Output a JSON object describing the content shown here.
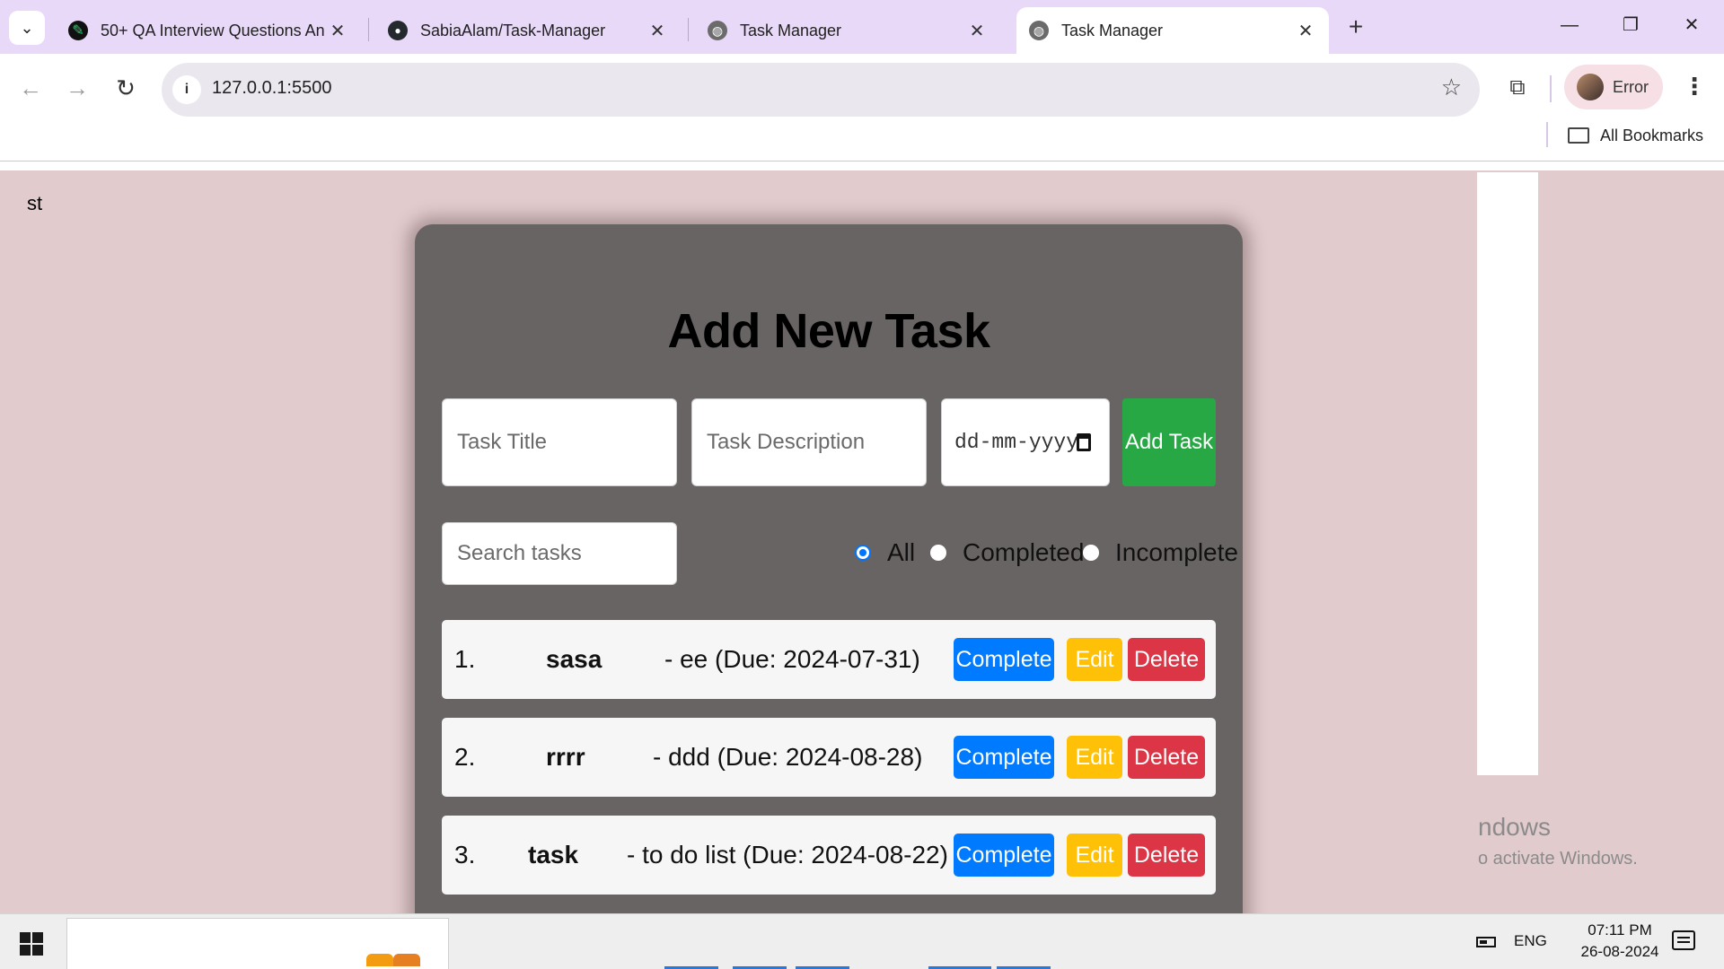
{
  "browser": {
    "tabs": [
      {
        "title": "50+ QA Interview Questions An",
        "active": false
      },
      {
        "title": "SabiaAlam/Task-Manager",
        "active": false
      },
      {
        "title": "Task Manager",
        "active": false
      },
      {
        "title": "Task Manager",
        "active": true
      }
    ],
    "url": "127.0.0.1:5500",
    "profile_label": "Error",
    "bookmarks_label": "All Bookmarks",
    "new_tab": "+",
    "close_glyph": "✕"
  },
  "page": {
    "corner_text": "st",
    "heading": "Add New Task",
    "form": {
      "title_placeholder": "Task Title",
      "description_placeholder": "Task Description",
      "date_placeholder": "dd-mm-yyyy",
      "add_button": "Add Task"
    },
    "search_placeholder": "Search tasks",
    "filters": [
      {
        "label": "All",
        "checked": true
      },
      {
        "label": "Completed",
        "checked": false
      },
      {
        "label": "Incomplete",
        "checked": false
      }
    ],
    "tasks": [
      {
        "num": "1.",
        "title": "sasa",
        "desc": "- ee (Due: 2024-07-31)"
      },
      {
        "num": "2.",
        "title": "rrrr",
        "desc": "- ddd (Due: 2024-08-28)"
      },
      {
        "num": "3.",
        "title": "task",
        "desc": "- to do list (Due: 2024-08-22)"
      }
    ],
    "buttons": {
      "complete": "Complete",
      "edit": "Edit",
      "delete": "Delete"
    }
  },
  "overlay": {
    "activate_line1": "ndows",
    "activate_line2": "o activate Windows."
  },
  "taskbar": {
    "language": "ENG",
    "time": "07:11 PM",
    "date": "26-08-2024"
  },
  "colors": {
    "page_bg": "#e2cbcd",
    "card_bg": "#686464",
    "add_green": "#28a745",
    "complete_blue": "#007bff",
    "edit_yellow": "#ffc107",
    "delete_red": "#dc3545",
    "tabstrip": "#e9d9f9"
  }
}
